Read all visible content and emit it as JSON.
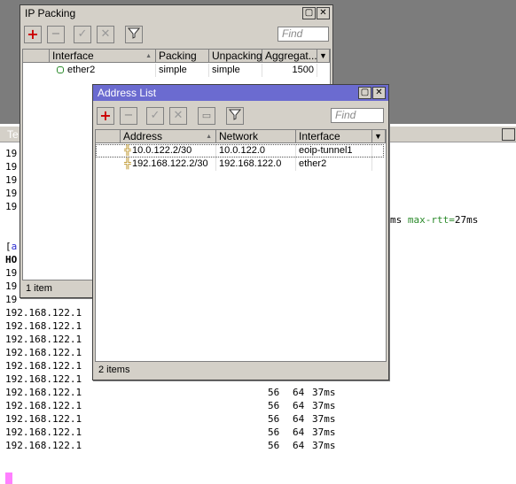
{
  "terminal": {
    "title": "Te",
    "lines_top": [
      "19",
      "19",
      "19",
      "19",
      "19"
    ],
    "stats_fragment_prefix": "ms ",
    "stats_fragment_key": "max-rtt=",
    "stats_fragment_value": "27ms",
    "prompt_fragment_open": "[",
    "prompt_fragment_a": "a",
    "header_fragment": "HO",
    "lines_mid": [
      "19",
      "19",
      "19"
    ],
    "rows": [
      {
        "ip": "192.168.122.1",
        "size": "",
        "ttl": "",
        "time": ""
      },
      {
        "ip": "192.168.122.1",
        "size": "",
        "ttl": "",
        "time": ""
      },
      {
        "ip": "192.168.122.1",
        "size": "",
        "ttl": "",
        "time": ""
      },
      {
        "ip": "192.168.122.1",
        "size": "",
        "ttl": "",
        "time": ""
      },
      {
        "ip": "192.168.122.1",
        "size": "",
        "ttl": "",
        "time": ""
      },
      {
        "ip": "192.168.122.1",
        "size": "",
        "ttl": "",
        "time": ""
      },
      {
        "ip": "192.168.122.1",
        "size": "56",
        "ttl": "64",
        "time": "37ms"
      },
      {
        "ip": "192.168.122.1",
        "size": "56",
        "ttl": "64",
        "time": "37ms"
      },
      {
        "ip": "192.168.122.1",
        "size": "56",
        "ttl": "64",
        "time": "37ms"
      },
      {
        "ip": "192.168.122.1",
        "size": "56",
        "ttl": "64",
        "time": "37ms"
      },
      {
        "ip": "192.168.122.1",
        "size": "56",
        "ttl": "64",
        "time": "37ms"
      }
    ]
  },
  "ip_packing": {
    "title": "IP Packing",
    "find_placeholder": "Find",
    "columns": [
      "Interface",
      "Packing",
      "Unpacking",
      "Aggregat..."
    ],
    "rows": [
      {
        "interface": "ether2",
        "packing": "simple",
        "unpacking": "simple",
        "aggregated": "1500"
      }
    ],
    "status": "1 item"
  },
  "address_list": {
    "title": "Address List",
    "find_placeholder": "Find",
    "columns": [
      "Address",
      "Network",
      "Interface"
    ],
    "rows": [
      {
        "address": "10.0.122.2/30",
        "network": "10.0.122.0",
        "interface": "eoip-tunnel1"
      },
      {
        "address": "192.168.122.2/30",
        "network": "192.168.122.0",
        "interface": "ether2"
      }
    ],
    "status": "2 items"
  },
  "colors": {
    "active_title": "#6b6bd0",
    "inactive_title": "#d4d0c8",
    "desktop": "#7c7c7c",
    "add_red": "#cc0000"
  },
  "icons": [
    "add-icon",
    "remove-icon",
    "enable-icon",
    "disable-icon",
    "comment-icon",
    "filter-icon",
    "maximize-icon",
    "close-icon",
    "menu-dropdown-icon",
    "address-icon",
    "running-dot-icon"
  ]
}
